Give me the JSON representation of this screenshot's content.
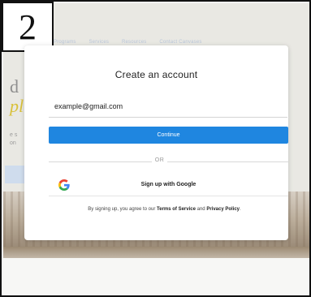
{
  "step": {
    "number": "2"
  },
  "background": {
    "nav_items": [
      "Programs",
      "Services",
      "Resources",
      "Contact Canvases"
    ],
    "hero_line1": "d",
    "hero_line2": "pl",
    "hero_text1": "e s",
    "hero_text2": "on"
  },
  "modal": {
    "title": "Create an account",
    "email_value": "example@gmail.com",
    "continue_label": "Continue",
    "divider_label": "OR",
    "google_label": "Sign up with Google",
    "legal_prefix": "By signing up, you agree to our ",
    "terms_label": "Terms of Service",
    "legal_and": " and ",
    "privacy_label": "Privacy Policy",
    "legal_suffix": "."
  },
  "colors": {
    "primary_button": "#1f86e0",
    "google_blue": "#4285F4",
    "google_red": "#EA4335",
    "google_yellow": "#FBBC05",
    "google_green": "#34A853"
  },
  "icons": {
    "google": "google-g-icon"
  }
}
